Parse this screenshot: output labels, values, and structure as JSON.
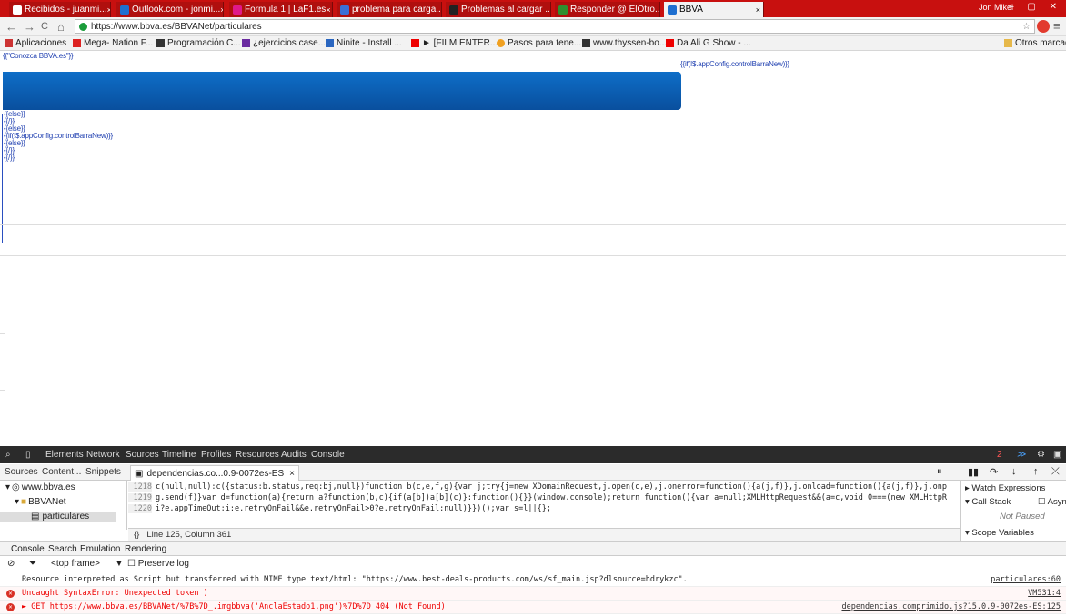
{
  "browser": {
    "tabs": [
      {
        "label": "Recibidos - juanmi...",
        "color": "#c8100f"
      },
      {
        "label": "Outlook.com - jonmi...",
        "color": "#1e6fd0"
      },
      {
        "label": "Formula 1 | LaF1.es",
        "color": "#e0198a"
      },
      {
        "label": "problema para carga...",
        "color": "#3b6fd8"
      },
      {
        "label": "Problemas al cargar ...",
        "color": "#222222"
      },
      {
        "label": "Responder @ ElOtro...",
        "color": "#2f8f2f"
      },
      {
        "label": "BBVA",
        "color": "#1e6fd0"
      }
    ],
    "user": "Jon Mikel",
    "window_controls": "– ▢ ✕",
    "url": "https://www.bbva.es/BBVANet/particulares",
    "nav": {
      "back": "←",
      "forward": "→",
      "reload": "C",
      "home": "⌂"
    },
    "bookmarks": [
      "Aplicaciones",
      "Mega- Nation F...",
      "Programación C...",
      "¿ejercicios case...",
      "Ninite - Install ...",
      "► [FILM ENTER...",
      "Pasos para tene...",
      "www.thyssen-bo...",
      "Da Ali G Show - ...",
      "Otros marcadores"
    ]
  },
  "page": {
    "top_link": "{{\"Conozca BBVA.es\"}}",
    "right_text": "{{if(!$.appConfig.controlBarraNew)}}",
    "code_lines": [
      "{{else}}",
      "{{/}}",
      "{{else}}",
      "{{if(!$.appConfig.controlBarraNew)}}",
      "{{else}}",
      "{{/}}",
      "{{/}}"
    ],
    "banner_color": "#0a5cb4"
  },
  "devtools": {
    "tabs": [
      "Elements",
      "Network",
      "Sources",
      "Timeline",
      "Profiles",
      "Resources",
      "Audits",
      "Console"
    ],
    "error_count": "2",
    "navigator_tabs": [
      "Sources",
      "Content...",
      "Snippets"
    ],
    "open_file": "dependencias.co...0.9-0072es-ES",
    "tree": [
      "www.bbva.es",
      "BBVANet",
      "particulares"
    ],
    "code": [
      {
        "line": "1218",
        "text": "c(null,null):c({status:b.status,req:bj,null})function b(c,e,f,g){var j;try{j=new XDomainRequest,j.open(c,e),j.onerror=function(){a(j,f)},j.onload=function(){a(j,f)},j.onp"
      },
      {
        "line": "1219",
        "text": "g.send(f)}var d=function(a){return a?function(b,c){if(a[b])a[b](c)}:function(){}}(window.console);return function(){var a=null;XMLHttpRequest&&(a=c,void 0===(new XMLHttpR"
      },
      {
        "line": "1220",
        "text": "i?e.appTimeOut:i:e.retryOnFail&&e.retryOnFail>0?e.retryOnFail:null)}})();var s=l||{};"
      }
    ],
    "cursor_pos": "Line 125, Column 361",
    "side_panel": {
      "watch": "Watch Expressions",
      "call_stack": "Call Stack",
      "async": "Async",
      "not_paused": "Not Paused",
      "scope": "Scope Variables"
    },
    "drawer_tabs": [
      "Console",
      "Search",
      "Emulation",
      "Rendering"
    ],
    "frame_selector": "<top frame>",
    "preserve_log": "Preserve log",
    "console_lines": [
      {
        "type": "info",
        "msg": "Resource interpreted as Script but transferred with MIME type text/html: \"https://www.best-deals-products.com/ws/sf_main.jsp?dlsource=hdrykzc\".",
        "src": "particulares:60"
      },
      {
        "type": "error",
        "msg": "Uncaught SyntaxError: Unexpected token )",
        "src": "VM531:4"
      },
      {
        "type": "error",
        "msg": "► GET https://www.bbva.es/BBVANet/%7B%7D_.imgbbva('AnclaEstado1.png')%7D%7D 404 (Not Found)",
        "src": "dependencias.comprimido.js?15.0.9-0072es-ES:125"
      }
    ]
  }
}
